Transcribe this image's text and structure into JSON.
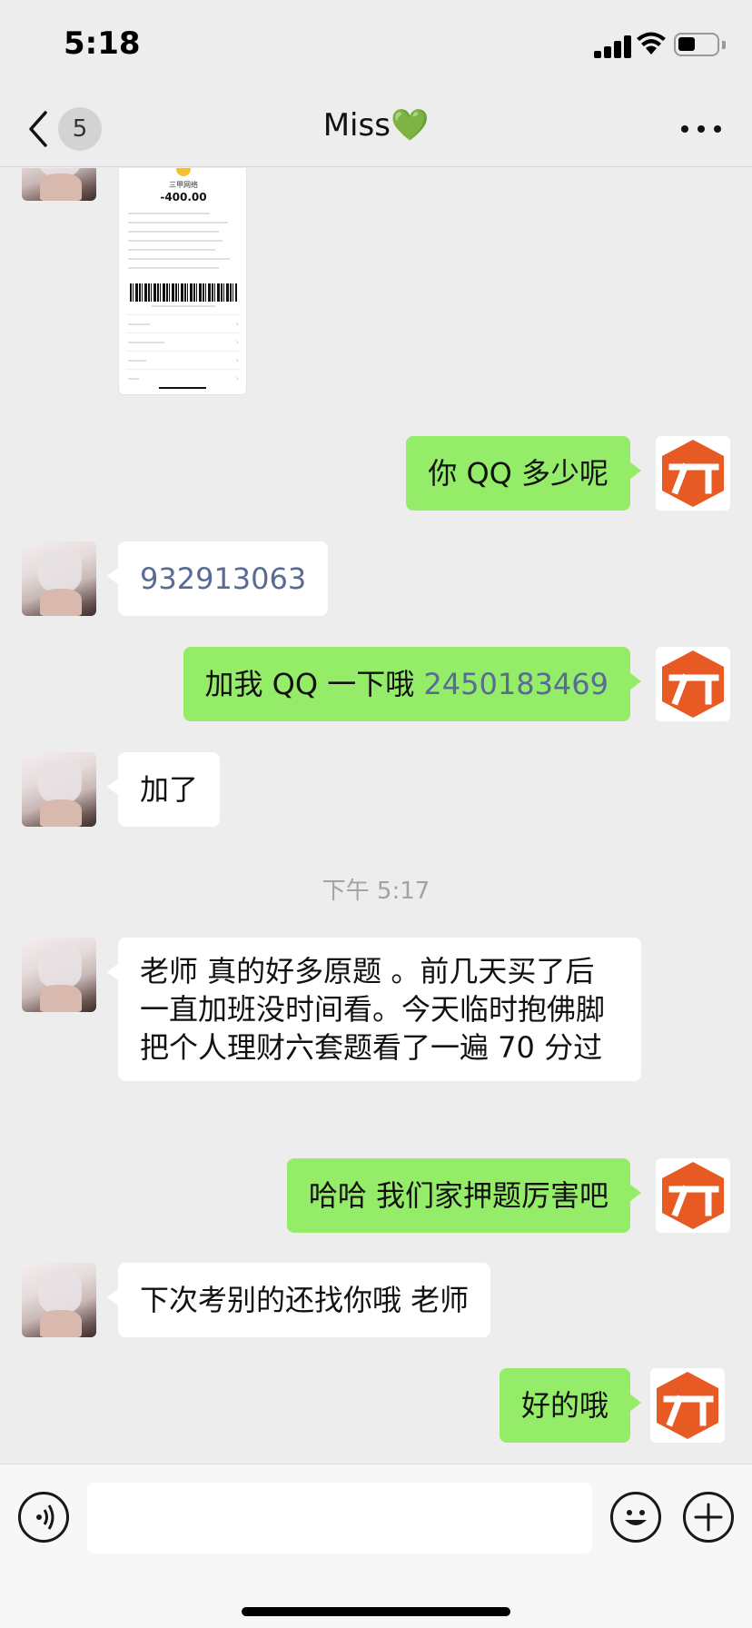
{
  "status_bar": {
    "time": "5:18"
  },
  "nav": {
    "back_badge": "5",
    "title": "Miss",
    "title_emoji": "💚"
  },
  "receipt": {
    "merchant": "三甲网络",
    "amount": "-400.00"
  },
  "messages": [
    {
      "side": "right",
      "text": "你 QQ 多少呢"
    },
    {
      "side": "left",
      "text": "932913063"
    },
    {
      "side": "right",
      "text": "加我 QQ 一下哦 ",
      "link": "2450183469"
    },
    {
      "side": "left",
      "text": "加了"
    },
    {
      "side": "left",
      "text": "老师 真的好多原题 。前几天买了后一直加班没时间看。今天临时抱佛脚把个人理财六套题看了一遍 70 分过"
    },
    {
      "side": "right",
      "text": "哈哈 我们家押题厉害吧"
    },
    {
      "side": "left",
      "text": "下次考别的还找你哦 老师"
    },
    {
      "side": "right",
      "text": "好的哦"
    }
  ],
  "timestamp": "下午 5:17",
  "colors": {
    "green_bubble": "#95ec69",
    "logo_orange": "#e85a24",
    "link_blue": "#576b95"
  },
  "icons": [
    "back-chevron-icon",
    "more-icon",
    "voice-icon",
    "emoji-icon",
    "plus-icon"
  ]
}
